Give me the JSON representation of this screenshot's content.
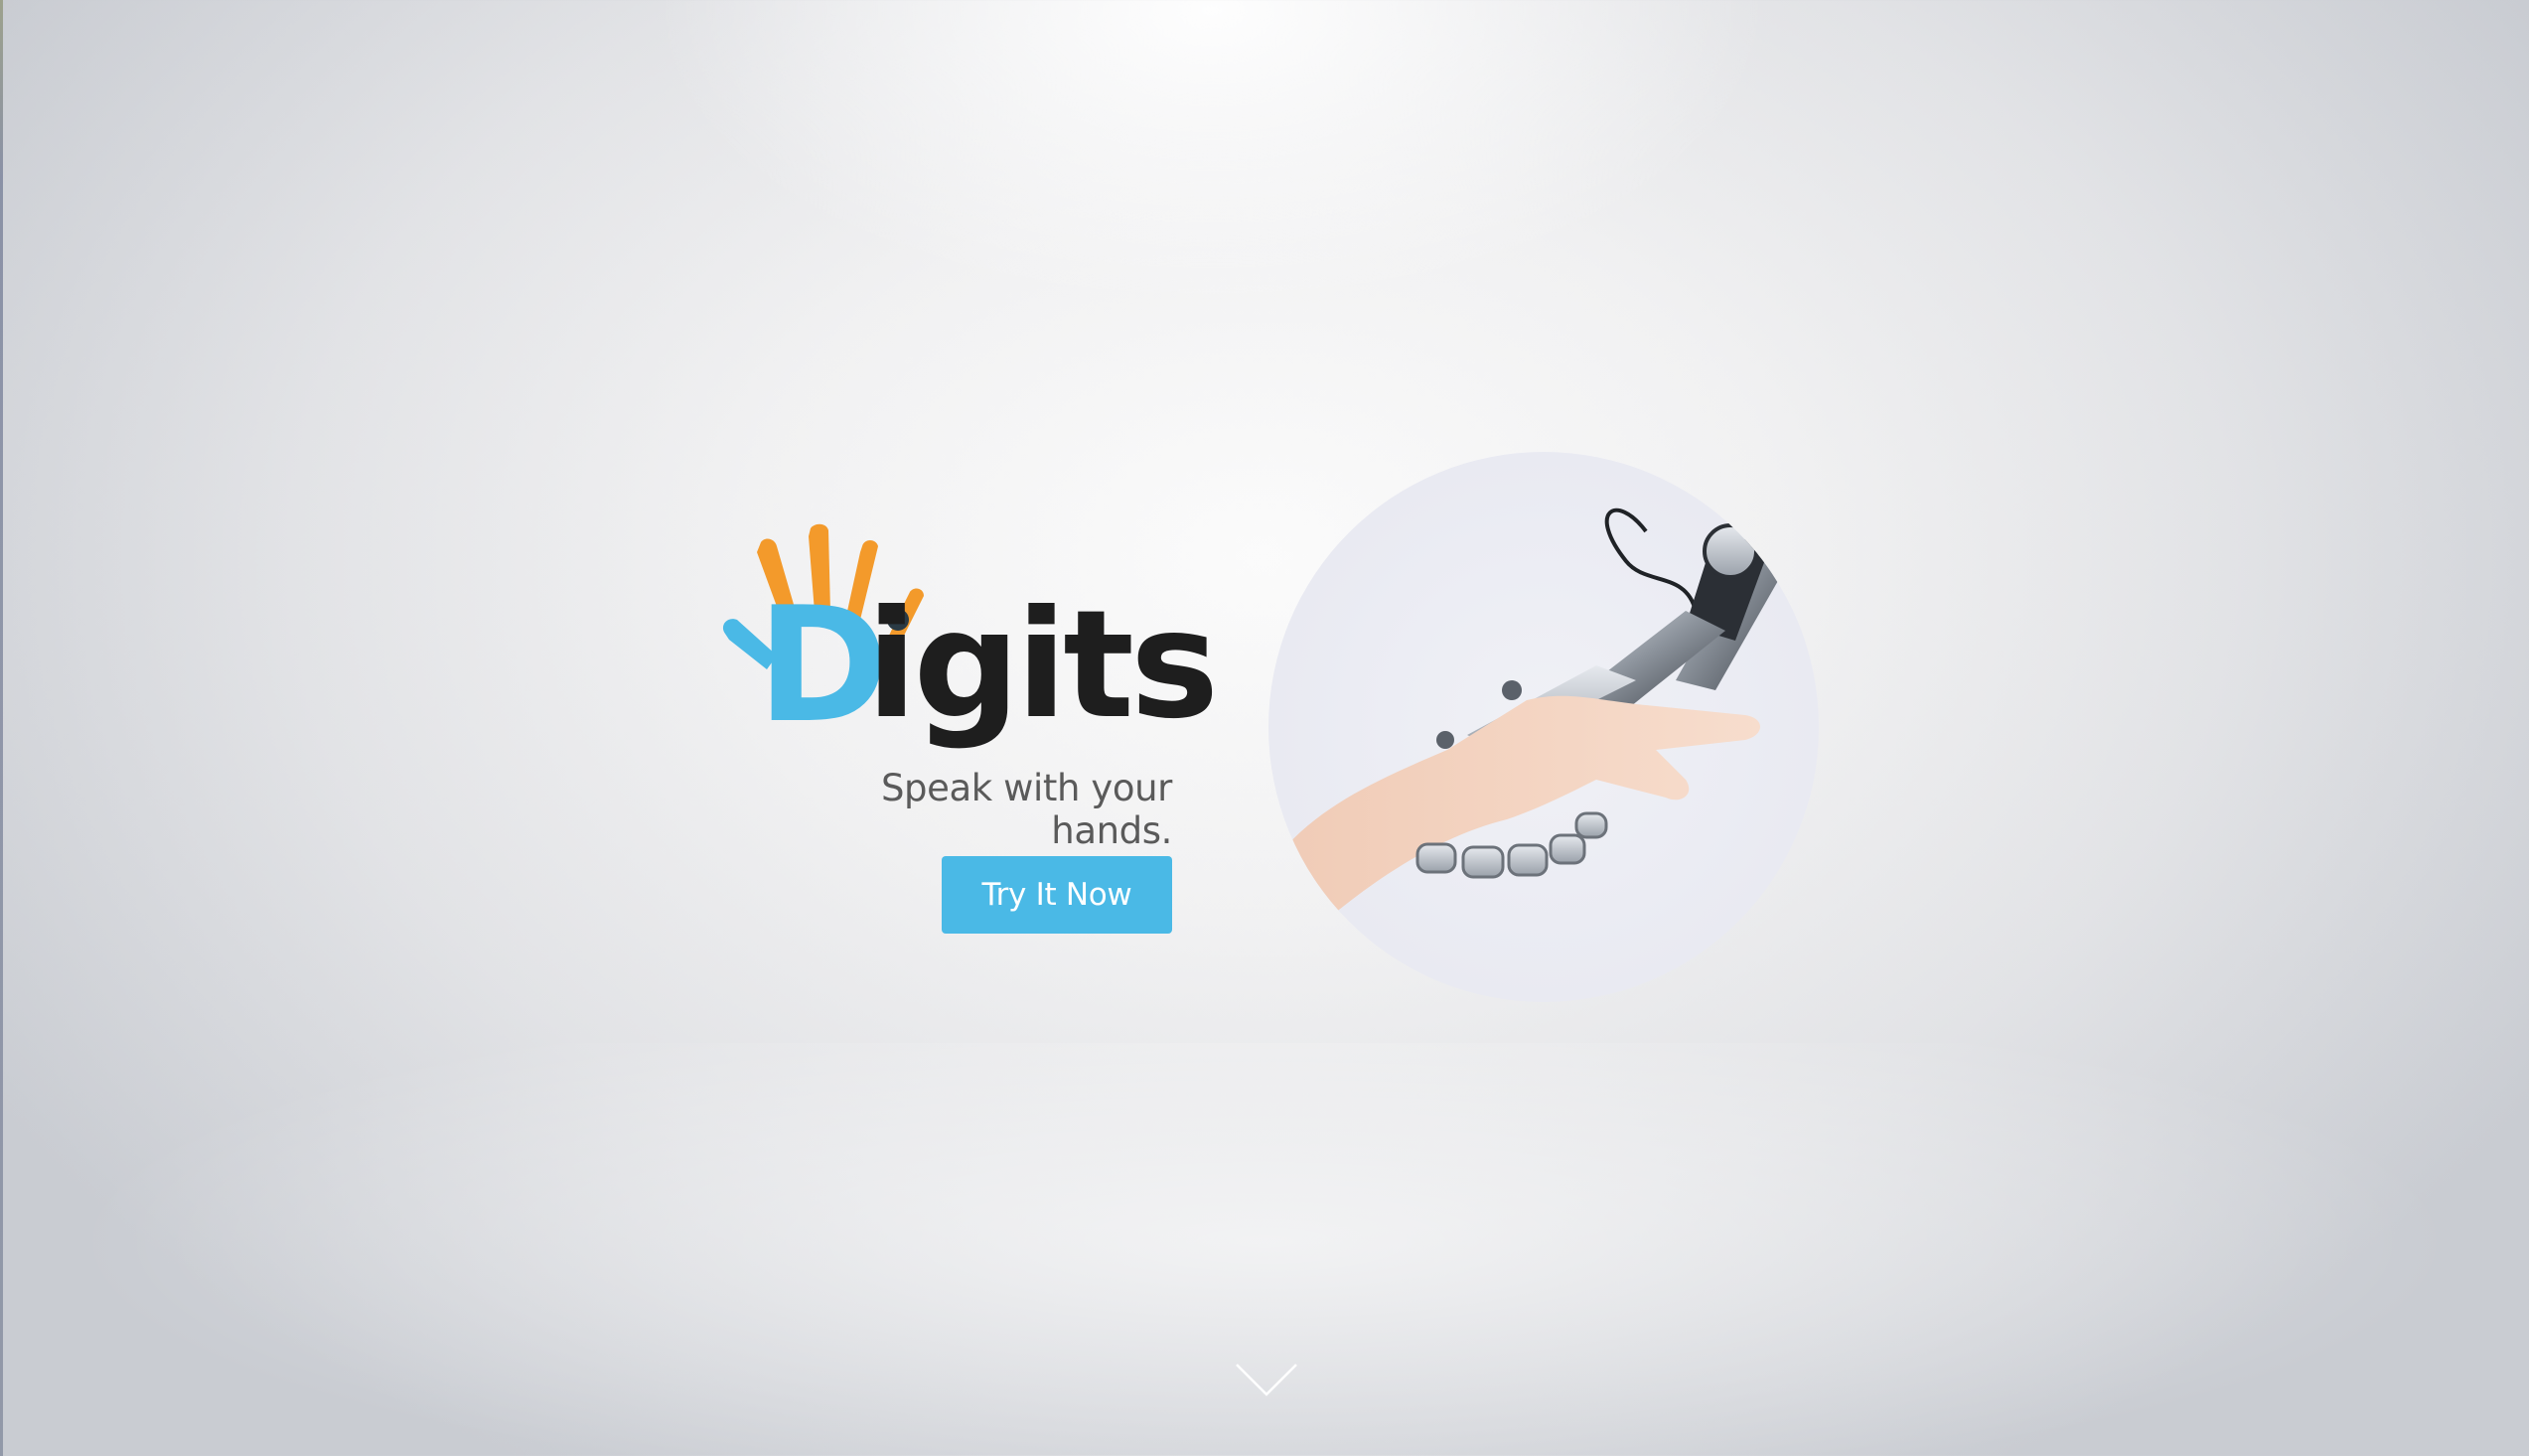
{
  "brand": {
    "name": "Digits",
    "logo_letter_d": "D",
    "logo_rest": "igits",
    "tagline": "Speak with your hands.",
    "colors": {
      "primary_blue": "#4ab9e6",
      "logo_orange": "#f39a2b",
      "logo_dark": "#1e1e1e"
    }
  },
  "hero": {
    "cta_label": "Try It Now",
    "image_subject": "human-hand-shaking-robotic-hand",
    "icons": [
      "scroll-down-chevron-icon"
    ]
  }
}
